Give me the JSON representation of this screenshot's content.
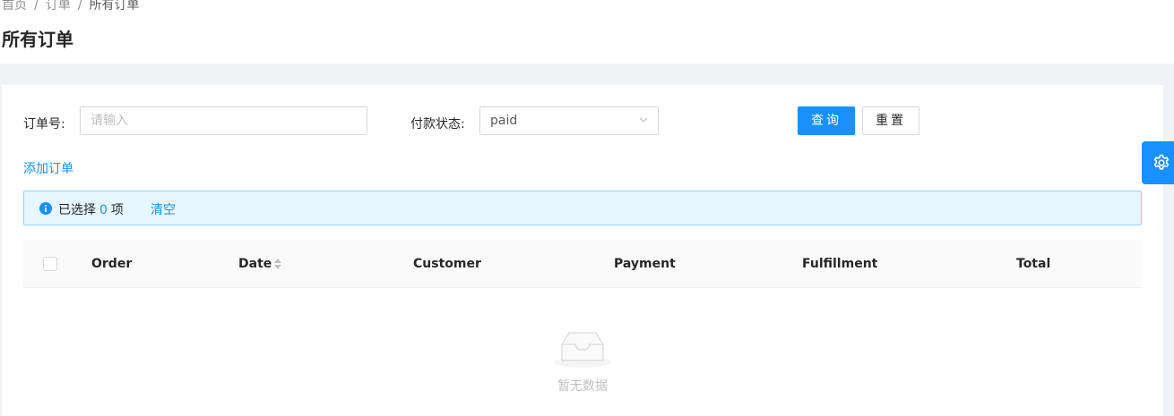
{
  "breadcrumb": {
    "items": [
      "首页",
      "订单",
      "所有订单"
    ],
    "separator": "/"
  },
  "page": {
    "title": "所有订单"
  },
  "filters": {
    "order_no_label": "订单号:",
    "order_no_placeholder": "请输入",
    "payment_status_label": "付款状态:",
    "payment_status_value": "paid"
  },
  "actions": {
    "query_label": "查询",
    "reset_label": "重置",
    "add_order_label": "添加订单"
  },
  "alert": {
    "prefix": "已选择",
    "count": "0",
    "suffix": "项",
    "clear_label": "清空"
  },
  "table": {
    "columns": [
      "Order",
      "Date",
      "Customer",
      "Payment",
      "Fulfillment",
      "Total"
    ],
    "empty_text": "暂无数据"
  },
  "icons": {
    "info": "info-circle-icon",
    "sort": "caret-sort-icon",
    "chevron": "chevron-down-icon",
    "empty": "empty-inbox-icon",
    "settings": "gear-icon"
  },
  "colors": {
    "primary": "#1890ff",
    "alert_bg": "#e6f7ff",
    "alert_border": "#91d5ff"
  }
}
